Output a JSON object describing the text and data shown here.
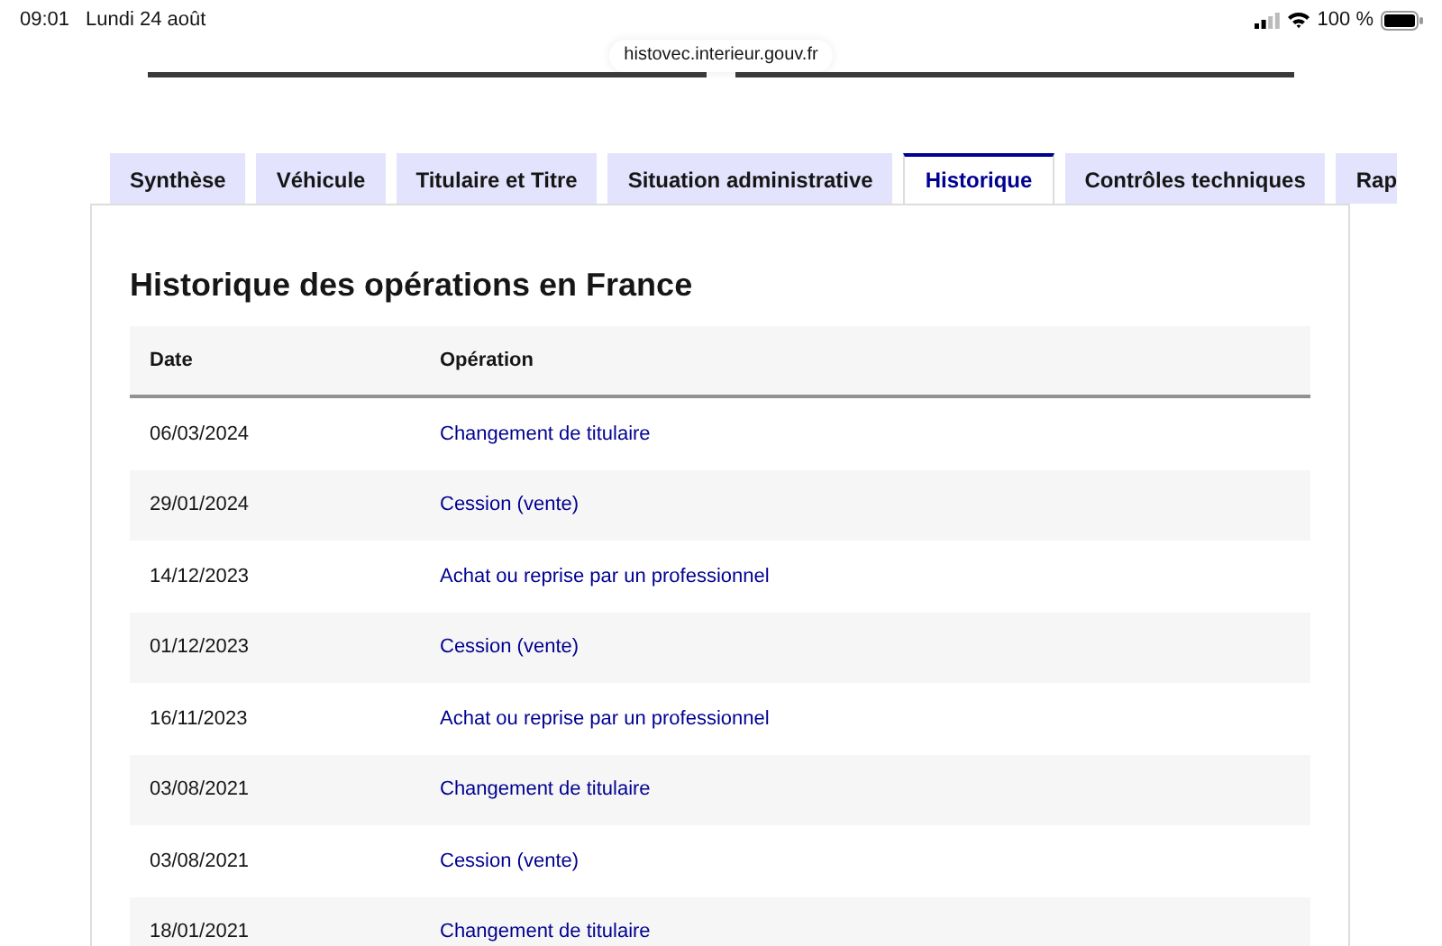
{
  "status_bar": {
    "time": "09:01",
    "date": "Lundi 24 août",
    "battery": "100 %"
  },
  "address_bar": {
    "url": "histovec.interieur.gouv.fr"
  },
  "tabs": [
    {
      "label": "Synthèse",
      "selected": false
    },
    {
      "label": "Véhicule",
      "selected": false
    },
    {
      "label": "Titulaire et Titre",
      "selected": false
    },
    {
      "label": "Situation administrative",
      "selected": false
    },
    {
      "label": "Historique",
      "selected": true
    },
    {
      "label": "Contrôles techniques",
      "selected": false
    },
    {
      "label": "Rap",
      "selected": false
    }
  ],
  "panel": {
    "title": "Historique des opérations en France",
    "table": {
      "columns": [
        "Date",
        "Opération"
      ],
      "rows": [
        [
          "06/03/2024",
          "Changement de titulaire"
        ],
        [
          "29/01/2024",
          "Cession (vente)"
        ],
        [
          "14/12/2023",
          "Achat ou reprise par un professionnel"
        ],
        [
          "01/12/2023",
          "Cession (vente)"
        ],
        [
          "16/11/2023",
          "Achat ou reprise par un professionnel"
        ],
        [
          "03/08/2021",
          "Changement de titulaire"
        ],
        [
          "03/08/2021",
          "Cession (vente)"
        ],
        [
          "18/01/2021",
          "Changement de titulaire"
        ]
      ]
    }
  }
}
